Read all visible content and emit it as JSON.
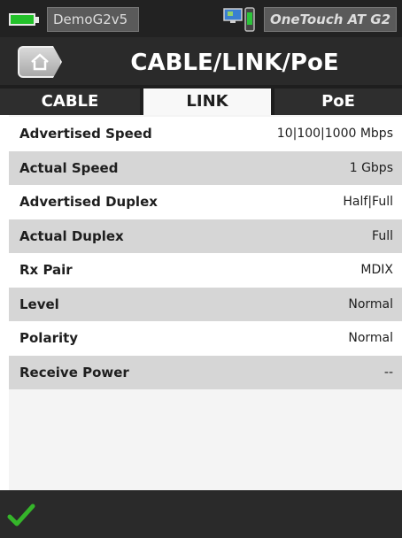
{
  "status_bar": {
    "device_name": "DemoG2v5",
    "product_name": "OneTouch AT G2",
    "battery_icon": "battery-full-icon",
    "monitor_icon": "monitor-icon",
    "usb_icon": "usb-drive-icon",
    "battery_color": "#23c12a"
  },
  "header": {
    "title": "CABLE/LINK/PoE",
    "home_icon": "home-icon"
  },
  "tabs": [
    {
      "label": "CABLE",
      "active": false
    },
    {
      "label": "LINK",
      "active": true
    },
    {
      "label": "PoE",
      "active": false
    }
  ],
  "rows": [
    {
      "label": "Advertised Speed",
      "value": "10|100|1000 Mbps"
    },
    {
      "label": "Actual Speed",
      "value": "1 Gbps"
    },
    {
      "label": "Advertised Duplex",
      "value": "Half|Full"
    },
    {
      "label": "Actual Duplex",
      "value": "Full"
    },
    {
      "label": "Rx Pair",
      "value": "MDIX"
    },
    {
      "label": "Level",
      "value": "Normal"
    },
    {
      "label": "Polarity",
      "value": "Normal"
    },
    {
      "label": "Receive Power",
      "value": "--"
    }
  ],
  "footer": {
    "check_icon": "checkmark-icon",
    "check_color": "#35b52a"
  }
}
